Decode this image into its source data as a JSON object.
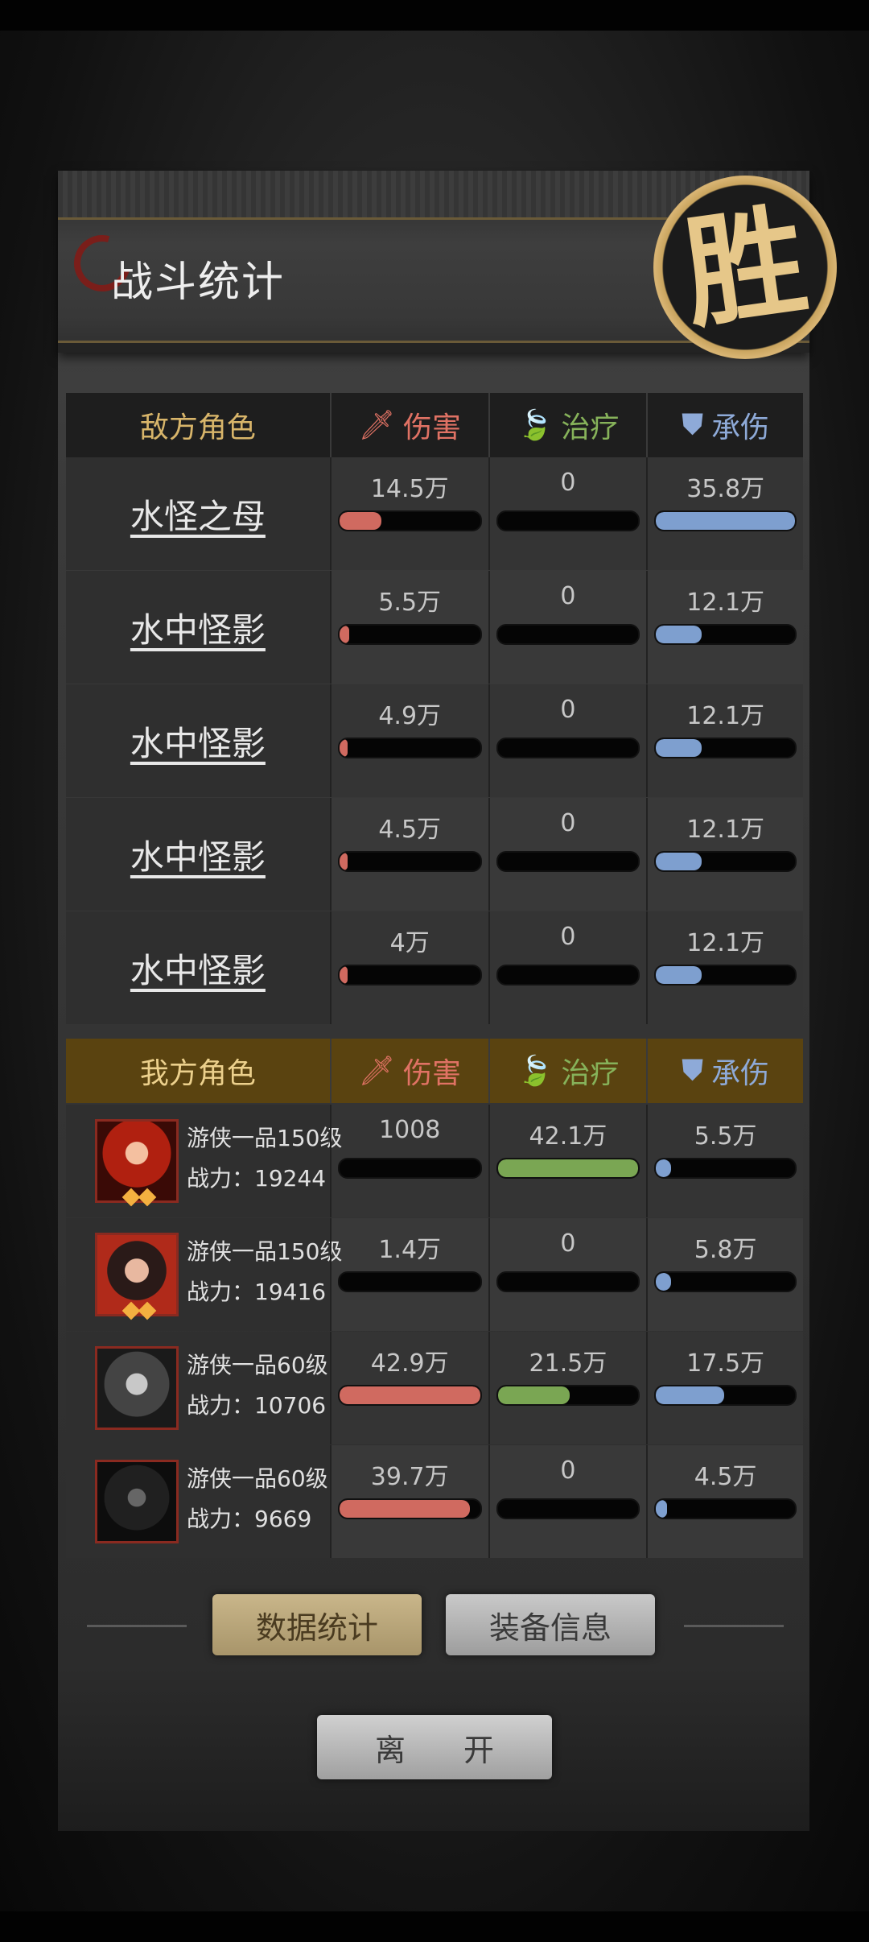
{
  "title": "战斗统计",
  "seal": "胜",
  "columns": {
    "damage": "伤害",
    "heal": "治疗",
    "tank": "承伤"
  },
  "enemy": {
    "header": "敌方角色",
    "rows": [
      {
        "name": "水怪之母",
        "damage": "14.5万",
        "damage_pct": 0.3,
        "heal": "0",
        "heal_pct": 0,
        "tank": "35.8万",
        "tank_pct": 1.0
      },
      {
        "name": "水中怪影",
        "damage": "5.5万",
        "damage_pct": 0.07,
        "heal": "0",
        "heal_pct": 0,
        "tank": "12.1万",
        "tank_pct": 0.33
      },
      {
        "name": "水中怪影",
        "damage": "4.9万",
        "damage_pct": 0.06,
        "heal": "0",
        "heal_pct": 0,
        "tank": "12.1万",
        "tank_pct": 0.33
      },
      {
        "name": "水中怪影",
        "damage": "4.5万",
        "damage_pct": 0.05,
        "heal": "0",
        "heal_pct": 0,
        "tank": "12.1万",
        "tank_pct": 0.33
      },
      {
        "name": "水中怪影",
        "damage": "4万",
        "damage_pct": 0.04,
        "heal": "0",
        "heal_pct": 0,
        "tank": "12.1万",
        "tank_pct": 0.33
      }
    ]
  },
  "ally": {
    "header": "我方角色",
    "rows": [
      {
        "title": "游侠一品150级",
        "power": "战力：19244",
        "damage": "1008",
        "damage_pct": 0.0,
        "heal": "42.1万",
        "heal_pct": 1.0,
        "tank": "5.5万",
        "tank_pct": 0.11
      },
      {
        "title": "游侠一品150级",
        "power": "战力：19416",
        "damage": "1.4万",
        "damage_pct": 0.0,
        "heal": "0",
        "heal_pct": 0,
        "tank": "5.8万",
        "tank_pct": 0.11
      },
      {
        "title": "游侠一品60级",
        "power": "战力：10706",
        "damage": "42.9万",
        "damage_pct": 1.0,
        "heal": "21.5万",
        "heal_pct": 0.51,
        "tank": "17.5万",
        "tank_pct": 0.49
      },
      {
        "title": "游侠一品60级",
        "power": "战力：9669",
        "damage": "39.7万",
        "damage_pct": 0.93,
        "heal": "0",
        "heal_pct": 0,
        "tank": "4.5万",
        "tank_pct": 0.08
      }
    ]
  },
  "buttons": {
    "data_stats": "数据统计",
    "equip_info": "装备信息",
    "leave": "离 开"
  }
}
